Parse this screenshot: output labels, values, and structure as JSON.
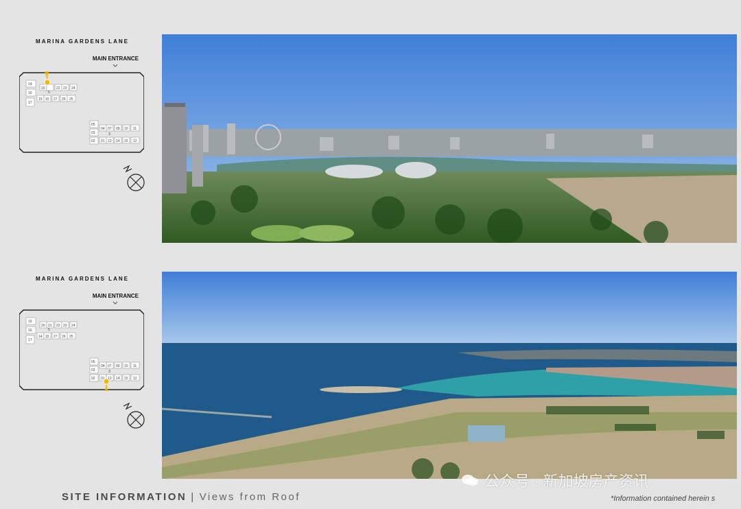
{
  "panels": [
    {
      "road_label": "MARINA GARDENS LANE",
      "entrance_label": "MAIN ENTRANCE",
      "units_left": [
        "14",
        "20",
        "21",
        "22",
        "23",
        "24",
        "16",
        "5",
        "19",
        "15",
        "27",
        "26",
        "25",
        "17"
      ],
      "units_right": [
        "05",
        "04",
        "07",
        "08",
        "09",
        "10",
        "11",
        "03",
        "02",
        "3",
        "01",
        "13",
        "14",
        "15",
        "12"
      ]
    },
    {
      "road_label": "MARINA GARDENS LANE",
      "entrance_label": "MAIN ENTRANCE",
      "units_left": [
        "19",
        "20",
        "21",
        "22",
        "23",
        "24",
        "16",
        "5",
        "19",
        "15",
        "27",
        "26",
        "25",
        "17"
      ],
      "units_right": [
        "05",
        "04",
        "07",
        "08",
        "09",
        "10",
        "11",
        "03",
        "02",
        "3",
        "01",
        "13",
        "14",
        "15",
        "12"
      ]
    }
  ],
  "footer": {
    "title": "SITE INFORMATION",
    "separator": "|",
    "subtitle": "Views from Roof",
    "disclaimer": "*Information contained herein s"
  },
  "watermark": "公众号 · 新加坡房产资讯",
  "colors": {
    "viewpoint": "#f5b800",
    "sky_top": "#3f7fd8",
    "sea": "#1f5a8a",
    "lagoon": "#2fa0a6"
  }
}
